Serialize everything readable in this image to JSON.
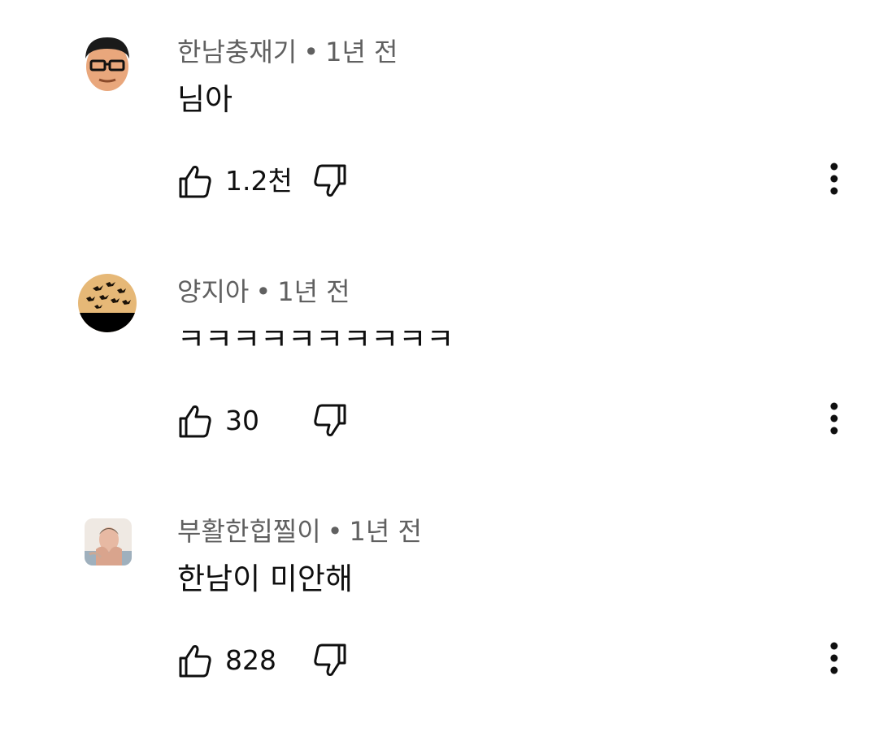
{
  "comments": [
    {
      "author": "한남충재기",
      "separator": "•",
      "time": "1년 전",
      "text": "님아",
      "likes": "1.2천",
      "avatar_icon": "man-glasses-avatar"
    },
    {
      "author": "양지아",
      "separator": "•",
      "time": "1년 전",
      "text": "ㅋㅋㅋㅋㅋㅋㅋㅋㅋㅋ",
      "likes": "30",
      "avatar_icon": "birds-sunset-avatar"
    },
    {
      "author": "부활한힙찔이",
      "separator": "•",
      "time": "1년 전",
      "text": "한남이 미안해",
      "likes": "828",
      "avatar_icon": "person-photo-avatar"
    }
  ],
  "icons": {
    "like": "thumbs-up-icon",
    "dislike": "thumbs-down-icon",
    "more": "more-vert-icon"
  },
  "colors": {
    "meta_text": "#606060",
    "body_text": "#0f0f0f",
    "background": "#ffffff"
  }
}
